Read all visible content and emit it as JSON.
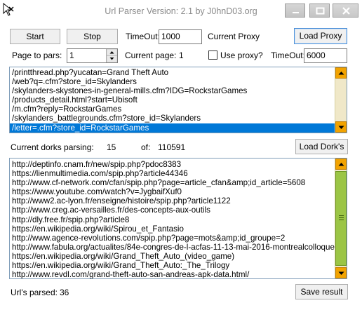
{
  "window": {
    "title": "Url Parser Version: 2.1 by J0hnD03.org"
  },
  "toolbar": {
    "start_label": "Start",
    "stop_label": "Stop",
    "timeout_label": "TimeOut:",
    "timeout_value": "1000",
    "current_proxy_label": "Current Proxy",
    "load_proxy_label": "Load Proxy"
  },
  "options": {
    "page_to_pars_label": "Page to pars:",
    "page_to_pars_value": "1",
    "current_page_label": "Current page:",
    "current_page_value": "1",
    "use_proxy_label": "Use proxy?",
    "use_proxy_checked": false,
    "timeout2_label": "TimeOut:",
    "timeout2_value": "6000"
  },
  "dorks": {
    "items": [
      "/printthread.php?yucatan=Grand Theft Auto",
      "/web?q=.cfm?store_id=Skylanders",
      "/skylanders-skystones-in-general-mills.cfm?IDG=RockstarGames",
      "/products_detail.html?start=Ubisoft",
      "/m.cfm?reply=RockstarGames",
      "/skylanders_battlegrounds.cfm?store_id=Skylanders",
      "/letter=.cfm?store_id=RockstarGames"
    ],
    "selected_index": 6
  },
  "status": {
    "current_dorks_label": "Current dorks parsing:",
    "current_dorks_value": "15",
    "of_label": "of:",
    "of_value": "110591",
    "load_dorks_label": "Load Dork's"
  },
  "results": {
    "items": [
      "http://deptinfo.cnam.fr/new/spip.php?pdoc8383",
      "https://lienmultimedia.com/spip.php?article44346",
      "http://www.cf-network.com/cfan/spip.php?page=article_cfan&amp;id_article=5608",
      "https://www.youtube.com/watch?v=JygbaifXuf0",
      "http://www2.ac-lyon.fr/enseigne/histoire/spip.php?article1122",
      "http://www.creg.ac-versailles.fr/des-concepts-aux-outils",
      "http://dly.free.fr/spip.php?article8",
      "https://en.wikipedia.org/wiki/Spirou_et_Fantasio",
      "http://www.agence-revolutions.com/spip.php?page=mots&amp;id_groupe=2",
      "http://www.fabula.org/actualites/84e-congres-de-l-acfas-11-13-mai-2016-montrealcolloque-internationa",
      "https://en.wikipedia.org/wiki/Grand_Theft_Auto_(video_game)",
      "https://en.wikipedia.org/wiki/Grand_Theft_Auto:_The_Trilogy",
      "http://www.revdl.com/grand-theft-auto-san-andreas-apk-data.html/"
    ]
  },
  "footer": {
    "urls_parsed_label": "Url's parsed:",
    "urls_parsed_value": "36",
    "save_result_label": "Save result"
  },
  "colors": {
    "selection": "#0078d7",
    "scroll_button": "#f2a300",
    "scroll_thumb": "#9bc545",
    "scroll_track": "#f0e8c8"
  }
}
